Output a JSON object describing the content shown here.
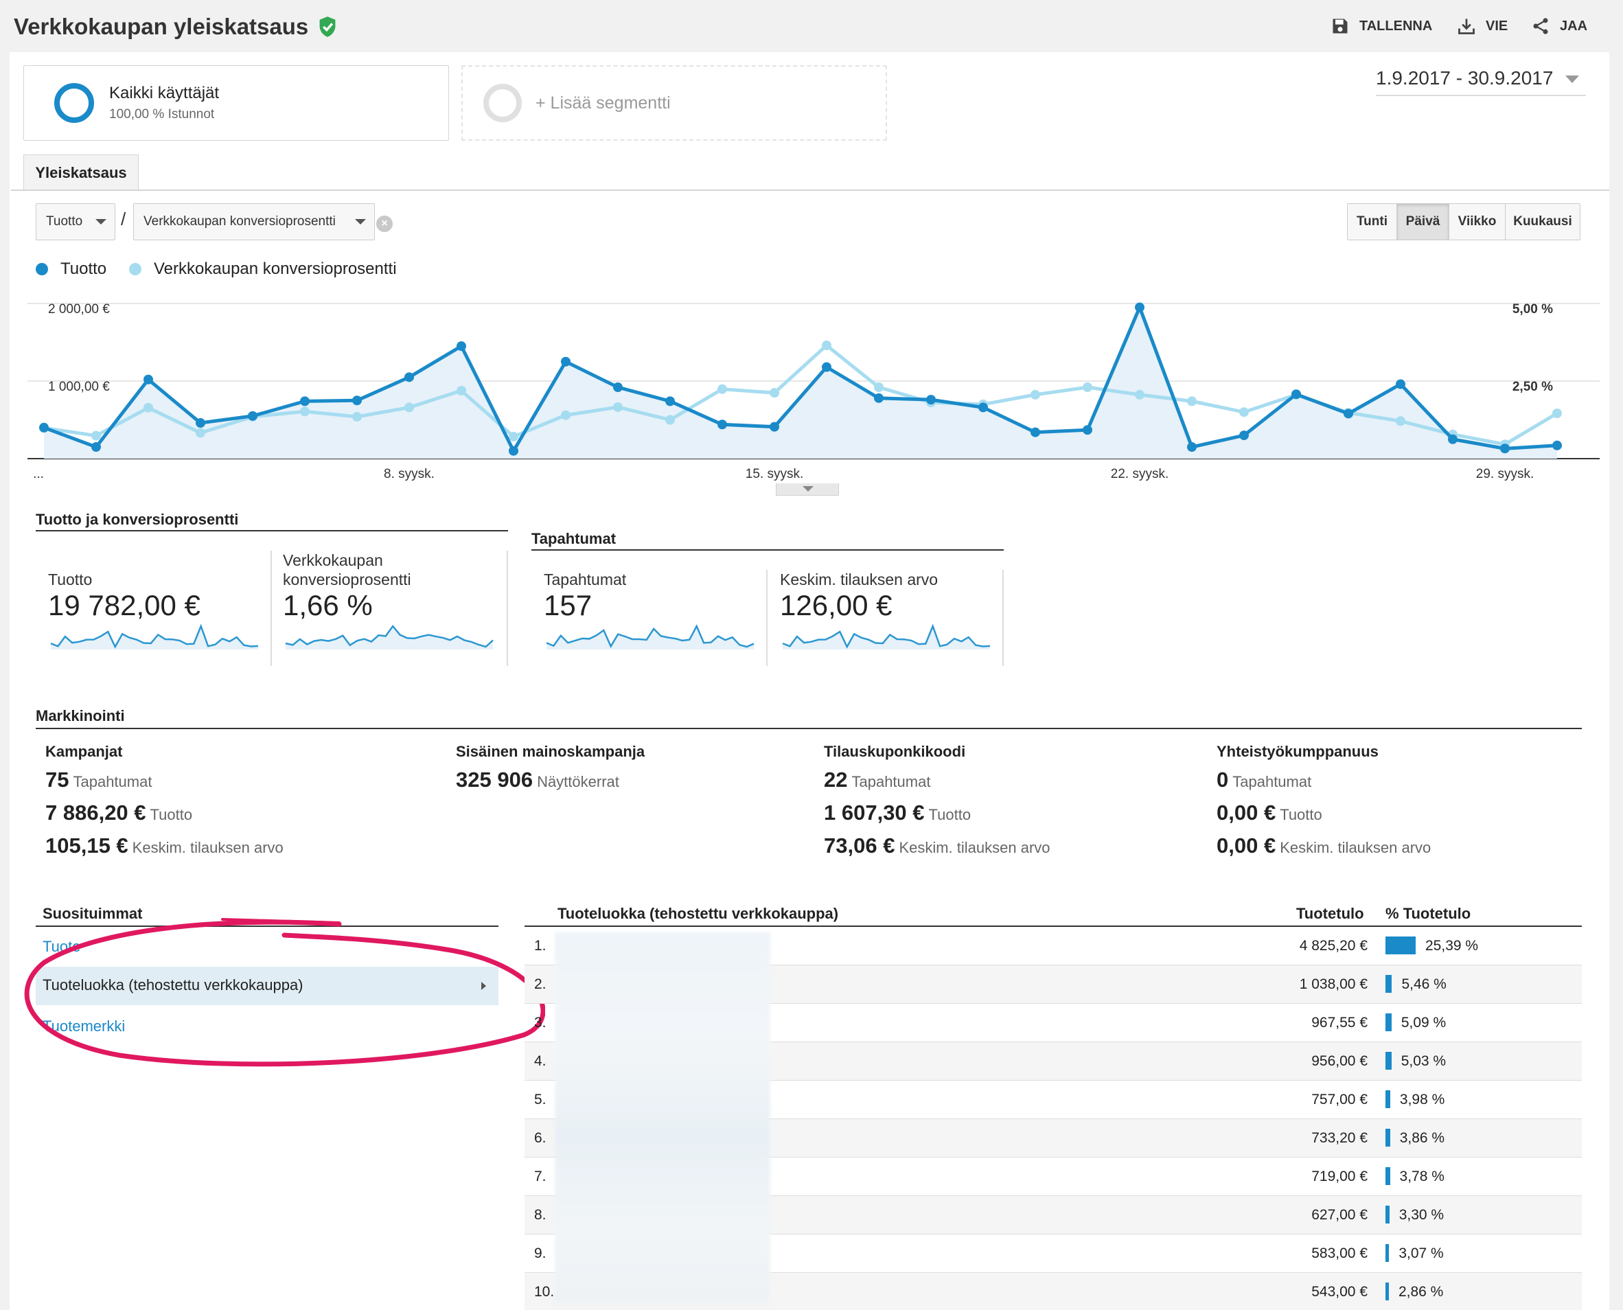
{
  "header": {
    "title": "Verkkokaupan yleiskatsaus",
    "actions": [
      {
        "label": "TALLENNA",
        "icon": "save-icon"
      },
      {
        "label": "VIE",
        "icon": "download-icon"
      },
      {
        "label": "JAA",
        "icon": "share-icon"
      }
    ]
  },
  "segments": {
    "all": {
      "name": "Kaikki käyttäjät",
      "sub": "100,00 % Istunnot"
    },
    "add_label": "+ Lisää segmentti"
  },
  "date_range": "1.9.2017 - 30.9.2017",
  "tab": "Yleiskatsaus",
  "selectors": {
    "metric1": "Tuotto",
    "separator": "/",
    "metric2": "Verkkokaupan konversioprosentti"
  },
  "granularity": [
    "Tunti",
    "Päivä",
    "Viikko",
    "Kuukausi"
  ],
  "granularity_active": "Päivä",
  "legend": [
    {
      "name": "Tuotto",
      "color": "#1a8ac9"
    },
    {
      "name": "Verkkokaupan konversioprosentti",
      "color": "#a6dcf0"
    }
  ],
  "chart_data": {
    "type": "line",
    "x_tick_labels": [
      "...",
      "8. syysk.",
      "15. syysk.",
      "22. syysk.",
      "29. syysk."
    ],
    "left_axis_ticks": [
      "2 000,00 €",
      "1 000,00 €"
    ],
    "right_axis_ticks": [
      "5,00 %",
      "2,50 %"
    ],
    "ylim_left": [
      0,
      2000
    ],
    "ylim_right": [
      0,
      5
    ],
    "grid": true,
    "series": [
      {
        "name": "Tuotto",
        "axis": "left",
        "color": "#1a8ac9",
        "values": [
          400,
          150,
          1020,
          460,
          550,
          740,
          750,
          1050,
          1450,
          100,
          1250,
          920,
          740,
          440,
          410,
          1180,
          780,
          760,
          660,
          340,
          370,
          1950,
          150,
          300,
          830,
          580,
          960,
          250,
          130,
          170
        ]
      },
      {
        "name": "Verkkokaupan konversioprosentti",
        "axis": "left_scaled",
        "color": "#a6dcf0",
        "values": [
          0.99,
          0.74,
          1.64,
          0.83,
          1.35,
          1.52,
          1.35,
          1.65,
          2.19,
          0.71,
          1.4,
          1.66,
          1.25,
          2.24,
          2.12,
          3.65,
          2.3,
          1.81,
          1.75,
          2.06,
          2.3,
          2.06,
          1.85,
          1.5,
          2.06,
          1.48,
          1.21,
          0.78,
          0.46,
          1.46
        ]
      }
    ]
  },
  "scorecards": {
    "group1": {
      "title": "Tuotto ja konversioprosentti",
      "cards": [
        {
          "label": "Tuotto",
          "value": "19 782,00 €"
        },
        {
          "label": "Verkkokaupan konversioprosentti",
          "value": "1,66 %"
        }
      ]
    },
    "group2": {
      "title": "Tapahtumat",
      "cards": [
        {
          "label": "Tapahtumat",
          "value": "157"
        },
        {
          "label": "Keskim. tilauksen arvo",
          "value": "126,00 €"
        }
      ]
    }
  },
  "marketing": {
    "title": "Markkinointi",
    "columns": [
      {
        "head": "Kampanjat",
        "rows": [
          {
            "value": "75",
            "label": "Tapahtumat"
          },
          {
            "value": "7 886,20 €",
            "label": "Tuotto"
          },
          {
            "value": "105,15 €",
            "label": "Keskim. tilauksen arvo"
          }
        ]
      },
      {
        "head": "Sisäinen mainoskampanja",
        "rows": [
          {
            "value": "325 906",
            "label": "Näyttökerrat"
          }
        ]
      },
      {
        "head": "Tilauskuponkikoodi",
        "rows": [
          {
            "value": "22",
            "label": "Tapahtumat"
          },
          {
            "value": "1 607,30 €",
            "label": "Tuotto"
          },
          {
            "value": "73,06 €",
            "label": "Keskim. tilauksen arvo"
          }
        ]
      },
      {
        "head": "Yhteistyökumppanuus",
        "rows": [
          {
            "value": "0",
            "label": "Tapahtumat"
          },
          {
            "value": "0,00 €",
            "label": "Tuotto"
          },
          {
            "value": "0,00 €",
            "label": "Keskim. tilauksen arvo"
          }
        ]
      }
    ]
  },
  "popular": {
    "title": "Suosituimmat",
    "items": [
      "Tuote",
      "Tuoteluokka (tehostettu verkkokauppa)",
      "Tuotemerkki"
    ],
    "selected_index": 1
  },
  "table": {
    "headers": [
      "Tuoteluokka (tehostettu verkkokauppa)",
      "Tuotetulo",
      "% Tuotetulo"
    ],
    "rows": [
      {
        "num": "1.",
        "rev": "4 825,20 €",
        "pct": "25,39 %",
        "share": 25.39
      },
      {
        "num": "2.",
        "rev": "1 038,00 €",
        "pct": "5,46 %",
        "share": 5.46
      },
      {
        "num": "3.",
        "rev": "967,55 €",
        "pct": "5,09 %",
        "share": 5.09
      },
      {
        "num": "4.",
        "rev": "956,00 €",
        "pct": "5,03 %",
        "share": 5.03
      },
      {
        "num": "5.",
        "rev": "757,00 €",
        "pct": "3,98 %",
        "share": 3.98
      },
      {
        "num": "6.",
        "rev": "733,20 €",
        "pct": "3,86 %",
        "share": 3.86
      },
      {
        "num": "7.",
        "rev": "719,00 €",
        "pct": "3,78 %",
        "share": 3.78
      },
      {
        "num": "8.",
        "rev": "627,00 €",
        "pct": "3,30 %",
        "share": 3.3
      },
      {
        "num": "9.",
        "rev": "583,00 €",
        "pct": "3,07 %",
        "share": 3.07
      },
      {
        "num": "10.",
        "rev": "543,00 €",
        "pct": "2,86 %",
        "share": 2.86
      }
    ]
  }
}
